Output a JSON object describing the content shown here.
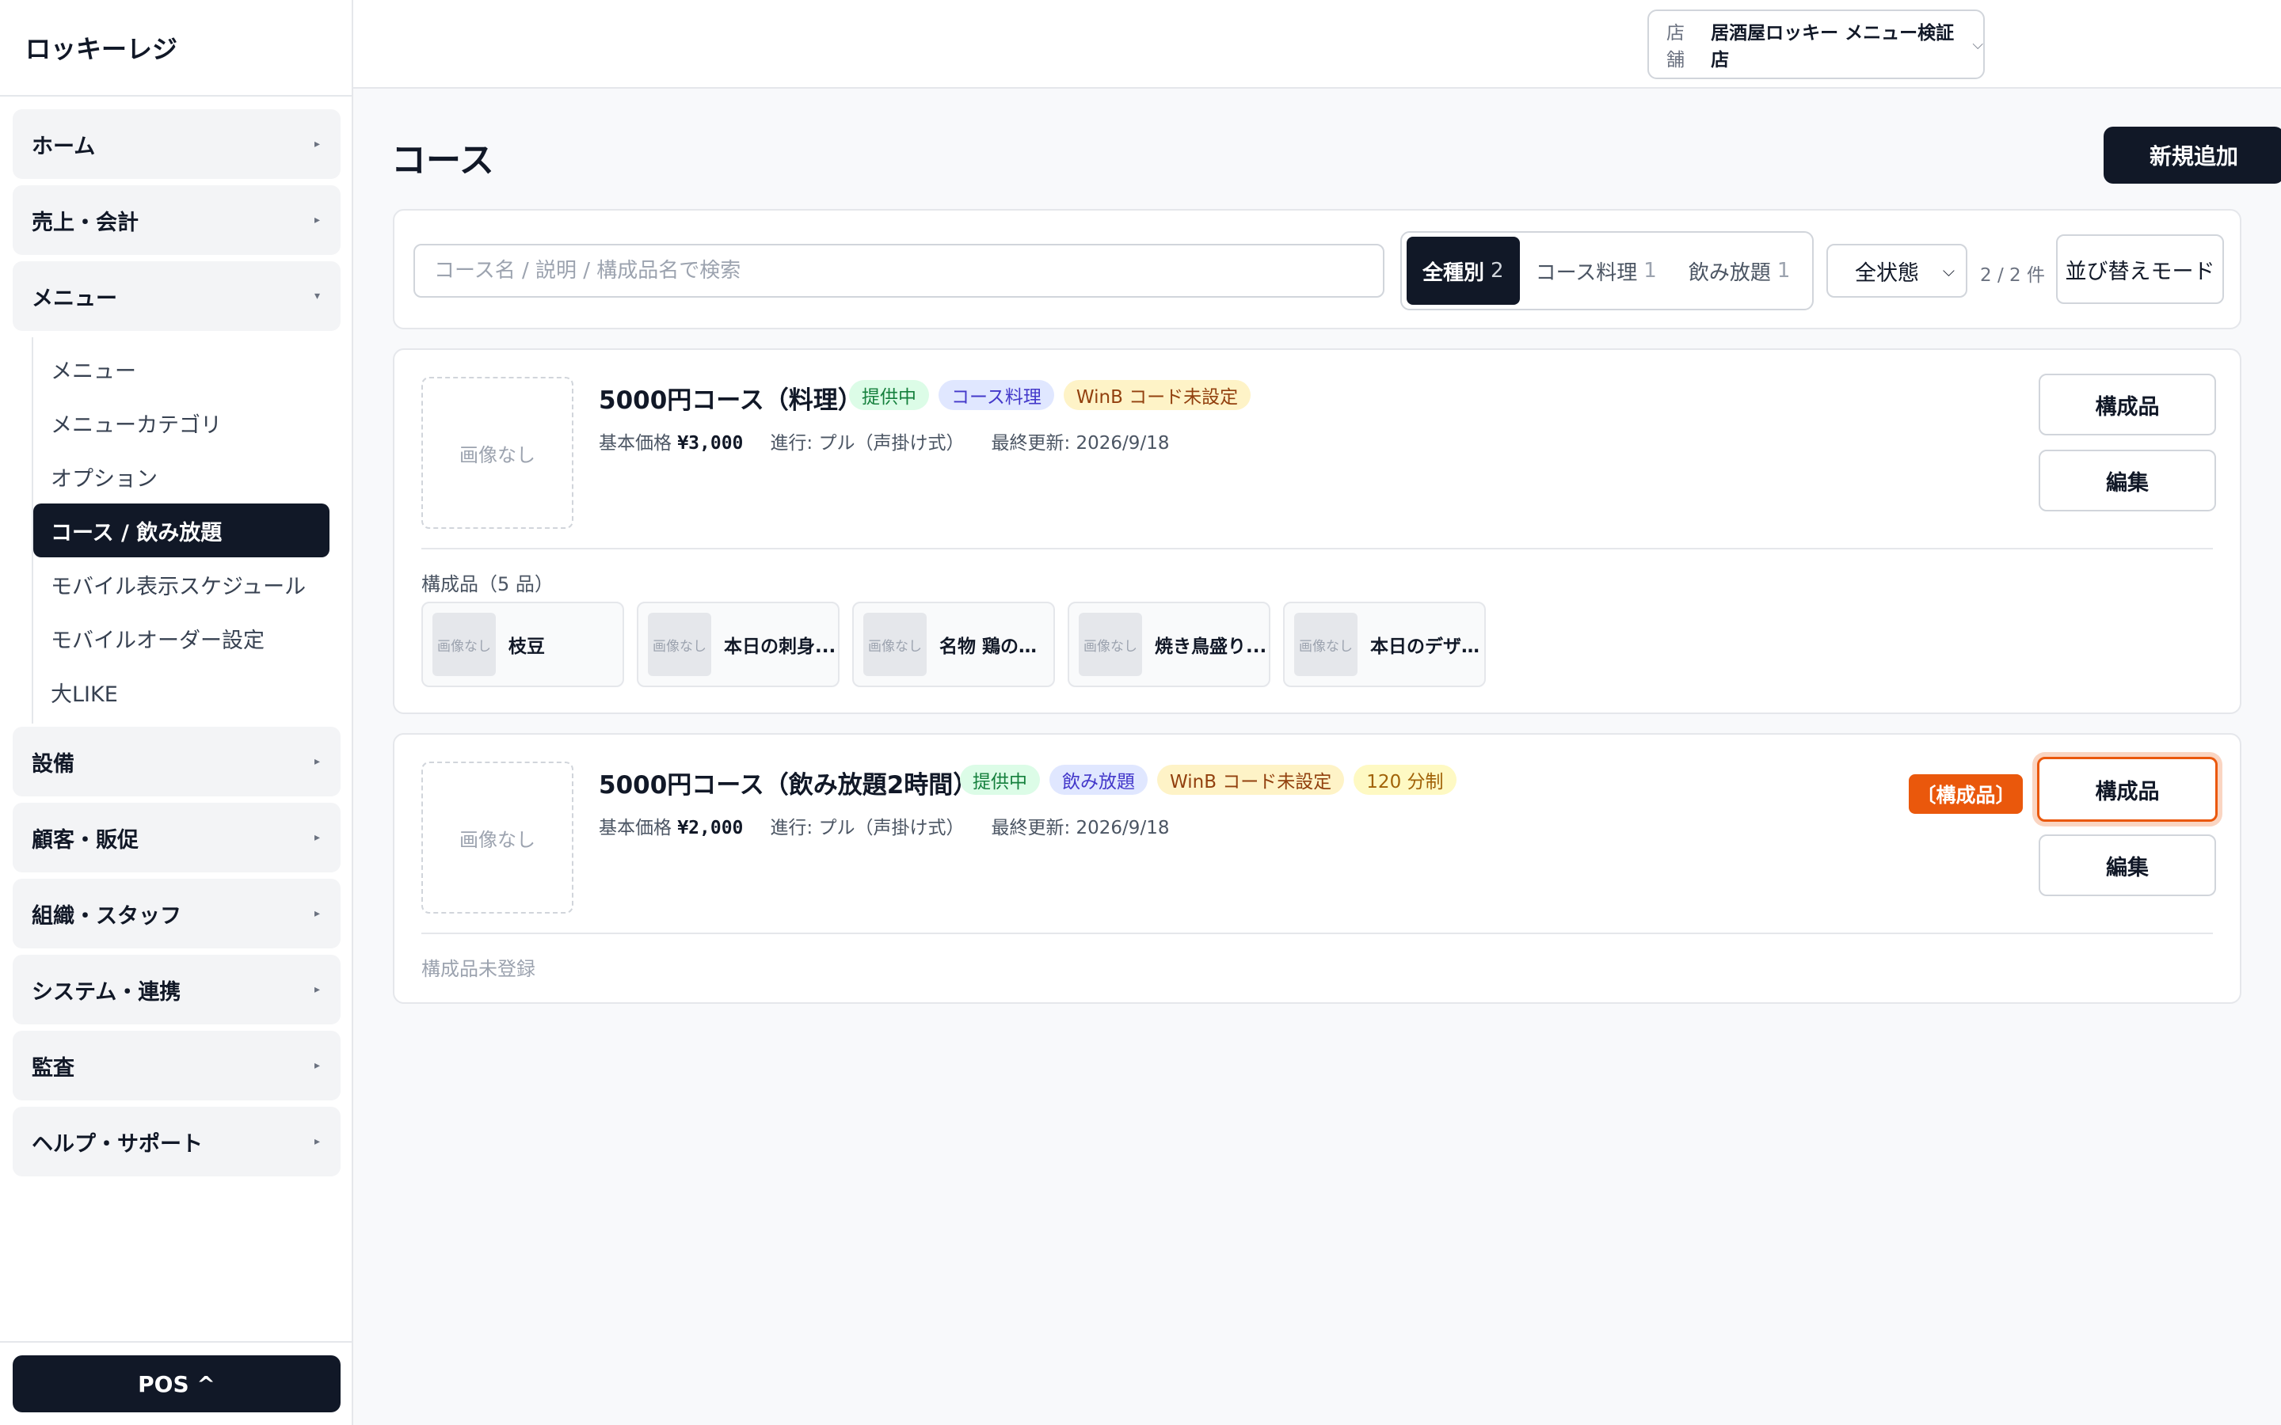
{
  "app": {
    "brand": "ロッキーレジ"
  },
  "sidebar": {
    "groups": [
      {
        "label": "ホーム"
      },
      {
        "label": "売上・会計"
      },
      {
        "label": "メニュー"
      },
      {
        "label": "設備"
      },
      {
        "label": "顧客・販促"
      },
      {
        "label": "組織・スタッフ"
      },
      {
        "label": "システム・連携"
      },
      {
        "label": "監査"
      },
      {
        "label": "ヘルプ・サポート"
      }
    ],
    "menu_subitems": [
      {
        "label": "メニュー"
      },
      {
        "label": "メニューカテゴリ"
      },
      {
        "label": "オプション"
      },
      {
        "label": "コース / 飲み放題"
      },
      {
        "label": "モバイル表示スケジュール"
      },
      {
        "label": "モバイルオーダー設定"
      },
      {
        "label": "大LIKE"
      }
    ],
    "arrow_collapsed": "▸",
    "arrow_expanded": "▾",
    "pos_button": "POS ^"
  },
  "topbar": {
    "store_label": "店舗",
    "store_value": "居酒屋ロッキー メニュー検証店",
    "chevron": "⌵"
  },
  "page": {
    "title": "コース",
    "new_button": "新規追加"
  },
  "filters": {
    "search_placeholder": "コース名 / 説明 / 構成品名で検索",
    "segments": [
      {
        "label": "全種別",
        "count": "2"
      },
      {
        "label": "コース料理",
        "count": "1"
      },
      {
        "label": "飲み放題",
        "count": "1"
      }
    ],
    "status_value": "全状態",
    "result_count": "2 / 2 件",
    "sort_button": "並び替えモード"
  },
  "courses": [
    {
      "title": "5000円コース（料理）",
      "image_placeholder": "画像なし",
      "badges": [
        "提供中",
        "コース料理",
        "WinB コード未設定"
      ],
      "price_label": "基本価格",
      "price": "¥3,000",
      "progress": "進行: プル（声掛け式）",
      "updated": "最終更新: 2026/9/18",
      "components_button": "構成品",
      "edit_button": "編集",
      "components_heading": "構成品（5 品）",
      "components": [
        {
          "thumb": "画像なし",
          "name": "枝豆"
        },
        {
          "thumb": "画像なし",
          "name": "本日の刺身..."
        },
        {
          "thumb": "画像なし",
          "name": "名物 鶏の唐..."
        },
        {
          "thumb": "画像なし",
          "name": "焼き鳥盛り..."
        },
        {
          "thumb": "画像なし",
          "name": "本日のデザート"
        }
      ]
    },
    {
      "title": "5000円コース（飲み放題2時間）",
      "image_placeholder": "画像なし",
      "badges": [
        "提供中",
        "飲み放題",
        "WinB コード未設定",
        "120 分制"
      ],
      "price_label": "基本価格",
      "price": "¥2,000",
      "progress": "進行: プル（声掛け式）",
      "updated": "最終更新: 2026/9/18",
      "tag": "〔構成品〕",
      "components_button": "構成品",
      "edit_button": "編集",
      "empty_components": "構成品未登録"
    }
  ],
  "colors": {
    "dark": "#111827",
    "accent_orange": "#ea580c",
    "badge_green": "#dcfce7",
    "badge_indigo": "#e0e7ff",
    "badge_amber": "#fef3c7"
  }
}
